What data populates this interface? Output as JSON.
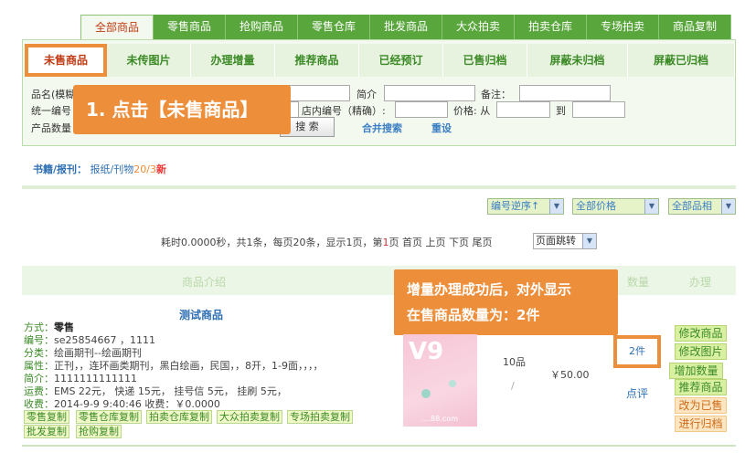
{
  "top_tabs": [
    {
      "label": "全部商品"
    },
    {
      "label": "零售商品"
    },
    {
      "label": "抢购商品"
    },
    {
      "label": "零售仓库"
    },
    {
      "label": "批发商品"
    },
    {
      "label": "大众拍卖"
    },
    {
      "label": "拍卖仓库"
    },
    {
      "label": "专场拍卖"
    },
    {
      "label": "商品复制"
    }
  ],
  "sub_tabs": [
    {
      "label": "未售商品"
    },
    {
      "label": "未传图片"
    },
    {
      "label": "办理增量"
    },
    {
      "label": "推荐商品"
    },
    {
      "label": "已经预订"
    },
    {
      "label": "已售归档"
    },
    {
      "label": "屏蔽未归档"
    },
    {
      "label": "屏蔽已归档"
    }
  ],
  "filter": {
    "name_label": "品名(模糊",
    "intro_label": "简介",
    "note_label": "备注：",
    "unified_label": "统一编号",
    "store_no_label": "店内编号（精确）:",
    "price_label": "价格: 从",
    "price_to_label": "到",
    "qty_label": "产品数量",
    "search_button": "搜 索",
    "combine_search": "合并搜索",
    "reset": "重设"
  },
  "callout1": "1. 点击【未售商品】",
  "category": {
    "root": "书籍/报刊",
    "sep": "：",
    "child": "报纸/刊物",
    "count1": "20",
    "slash": "/",
    "count2": "3",
    "new": "新"
  },
  "sorts": {
    "order": "编号逆序↑",
    "price": "全部价格",
    "grade": "全部品相"
  },
  "pager": {
    "before": "耗时0.0000秒，共1条，每页20条，显示1页，第",
    "current": "1",
    "after": "页   首页   上页   下页     尾页",
    "jump": "页面跳转"
  },
  "table_headers": {
    "intro": "商品介绍",
    "qty": "数量",
    "action": "办理"
  },
  "callout2": {
    "line1": "增量办理成功后，对外显示",
    "line2": "在售商品数量为：2件"
  },
  "product": {
    "title": "测试商品",
    "fields": [
      {
        "k": "方式：",
        "v": "零售"
      },
      {
        "k": "编号：",
        "v": "se25854667  ，1111"
      },
      {
        "k": "分类：",
        "v": "绘画期刊--绘画期刊"
      },
      {
        "k": "属性：",
        "v": "正刊，，连环画类期刊，黑白绘画，民国，，8开，1-9面，，，，"
      },
      {
        "k": "简介：",
        "v": "1111111111111"
      },
      {
        "k": "运费：",
        "v": "EMS 22元，  快递 15元，  挂号信 5元，  挂刷 5元，"
      },
      {
        "k": "收费：",
        "v": "2014-9-9 9:40:46   收费：￥0.0000"
      }
    ],
    "copy_tags_row1": [
      "零售复制",
      "零售仓库复制",
      "拍卖仓库复制",
      "大众拍卖复制",
      "专场拍卖复制"
    ],
    "copy_tags_row2": [
      "批发复制",
      "抢购复制"
    ],
    "grade": "10品",
    "price": "￥50.00",
    "slash": "/",
    "qty": "2件",
    "review": "点评",
    "thumb_logo": "V9",
    "thumb_footer": "....88.com"
  },
  "actions": [
    {
      "label": "修改商品",
      "style": "green"
    },
    {
      "label": "修改图片",
      "style": "green"
    },
    {
      "label": "增加数量",
      "style": "green"
    },
    {
      "label": "推荐商品",
      "style": "green"
    },
    {
      "label": "改为已售",
      "style": "orange"
    },
    {
      "label": "进行归档",
      "style": "orange"
    }
  ]
}
